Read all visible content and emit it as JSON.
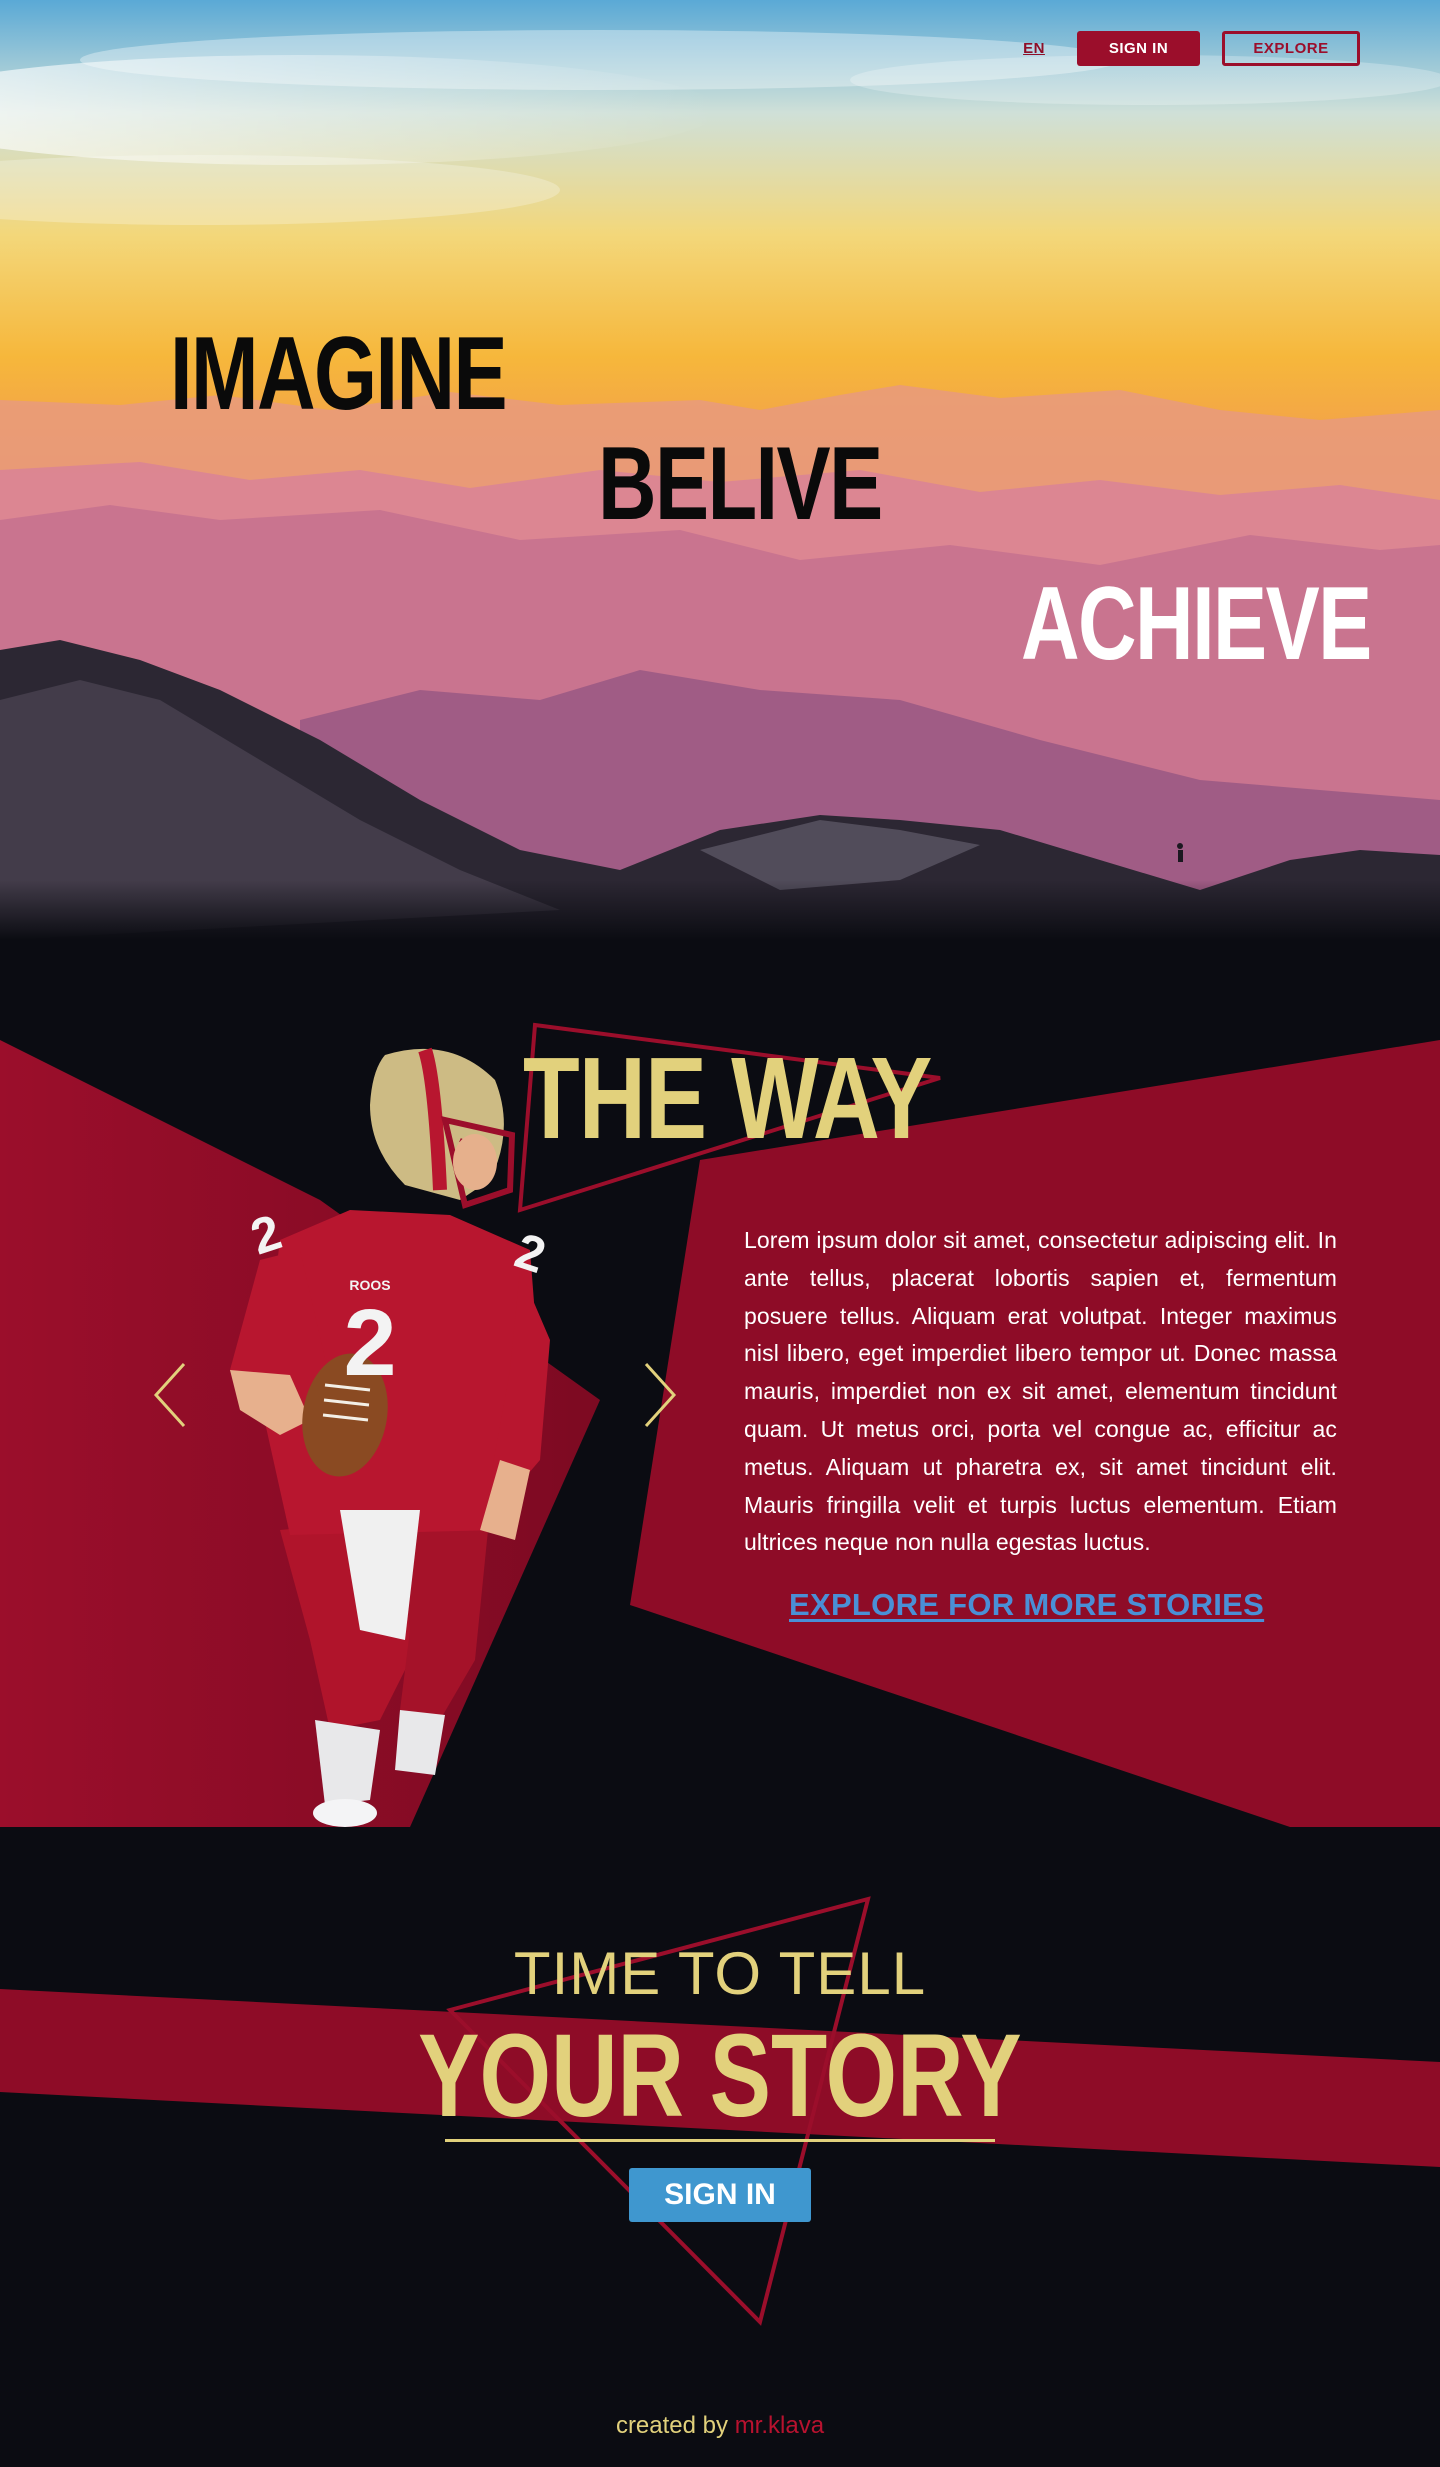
{
  "nav": {
    "lang": "EN",
    "sign_in": "SIGN IN",
    "explore": "EXPLORE"
  },
  "hero": {
    "words": [
      "IMAGINE",
      "BELIVE",
      "ACHIEVE"
    ]
  },
  "story": {
    "heading": "THE WAY",
    "body": "Lorem ipsum dolor sit amet, consectetur adipiscing elit. In ante tellus, placerat lobortis sapien et, fermentum posuere tellus. Aliquam erat volutpat. Integer maximus nisl libero, eget imperdiet libero tempor ut. Donec massa mauris, imperdiet non ex sit amet, elementum tincidunt quam. Ut metus orci, porta vel congue ac, efficitur ac metus. Aliquam ut pharetra ex, sit amet tincidunt elit. Mauris fringilla velit et turpis luctus elementum. Etiam ultrices neque non nulla egestas luctus.",
    "link": "EXPLORE FOR MORE STORIES",
    "jersey_number": "2",
    "jersey_text": "ROOS"
  },
  "cta": {
    "line1": "TIME TO TELL",
    "line2": "YOUR STORY",
    "button": "SIGN IN"
  },
  "footer": {
    "prefix": "created by",
    "author": "mr.klava"
  },
  "colors": {
    "crimson": "#9b0e2b",
    "gold": "#e2d17c",
    "dark": "#0b0c12",
    "link_blue": "#4a8fd6",
    "button_blue": "#3f97cf"
  },
  "icons": [
    "chevron-left-icon",
    "chevron-right-icon"
  ]
}
